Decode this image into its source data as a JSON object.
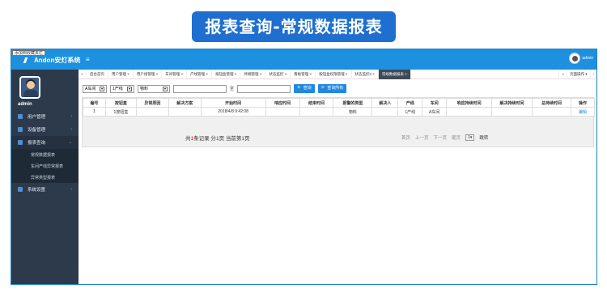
{
  "banner": {
    "title": "报表查询-常规数据报表"
  },
  "app": {
    "tip": "添加到收藏夹栏",
    "name": "Andon安灯系统",
    "menu_icon": "≡"
  },
  "user": {
    "top_name": "admin",
    "side_name": "admin"
  },
  "sidebar": {
    "items": [
      {
        "label": "用户管理",
        "chev": "›"
      },
      {
        "label": "设备管理",
        "chev": "›"
      },
      {
        "label": "报表查询",
        "chev": "⌄"
      },
      {
        "label": "系统设置",
        "chev": "›"
      }
    ],
    "subitems": [
      "常规数据报表",
      "车间产线异常报表",
      "异常类型报表"
    ]
  },
  "tabs": {
    "left_arrow": "«",
    "items": [
      "后台首页",
      "用户管理 ×",
      "用户组管理 ×",
      "车间管理 ×",
      "产线管理 ×",
      "按钮盒管理 ×",
      "终端管理 ×",
      "状态监控 ×",
      "看板管理 ×",
      "按钮盒权限管理 ×",
      "状态监控2 ×",
      "常规数据报表 ×"
    ],
    "right_arrow": "»",
    "page_ops": "页面操作 ▾",
    "next": "›"
  },
  "filters": {
    "workshop": "A车间",
    "line": "1产线",
    "category": "物料",
    "to_label": "至",
    "query_btn": "🔍 查询",
    "query_all_btn": "🔍 查询所有"
  },
  "table": {
    "headers": [
      "编号",
      "按钮盒",
      "异常原因",
      "解决方案",
      "开始时间",
      "响应时间",
      "结束时间",
      "报警的类型",
      "解决人",
      "产线",
      "车间",
      "响应持续时间",
      "解决持续时间",
      "总持续时间",
      "操作"
    ],
    "rows": [
      [
        "1",
        "1按钮盒",
        "",
        "",
        "2018/4/8 9:42:08",
        "",
        "",
        "物料",
        "",
        "1产线",
        "A车间",
        "",
        "",
        "",
        "编辑"
      ]
    ]
  },
  "pager": {
    "rec_prefix": "共",
    "rec_total": "1",
    "rec_mid": "条记录 分",
    "rec_pages": "1",
    "rec_mid2": "页 当前第",
    "rec_cur": "1",
    "rec_suffix": "页",
    "first": "首页",
    "prev": "上一页",
    "next": "下一页",
    "last": "尾页",
    "page_value": "1",
    "jump": "跳转"
  }
}
